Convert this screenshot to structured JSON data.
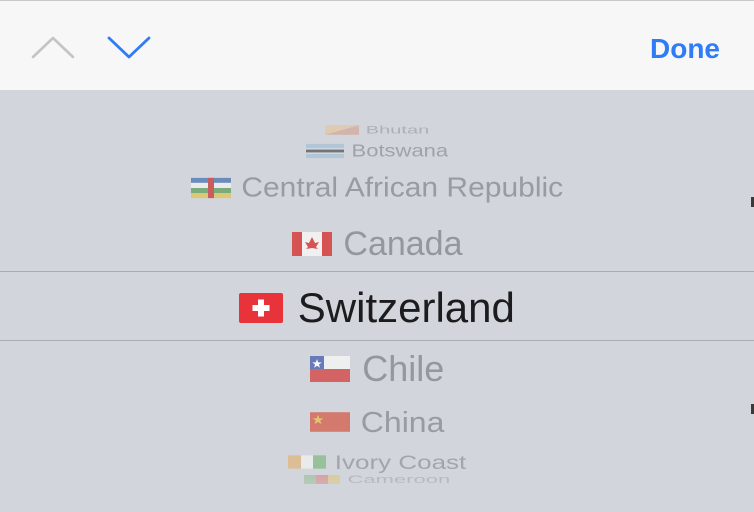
{
  "toolbar": {
    "previous_icon": "chevron-up-icon",
    "next_icon": "chevron-down-icon",
    "done_label": "Done",
    "accent": "#2f7cf6",
    "disabled_color": "#c4c4c6"
  },
  "picker": {
    "selected_country": "Switzerland",
    "rows": [
      {
        "label": "Bhutan",
        "flag": "flag-bhutan"
      },
      {
        "label": "Botswana",
        "flag": "flag-botswana"
      },
      {
        "label": "Central African Republic",
        "flag": "flag-central-african-republic"
      },
      {
        "label": "Canada",
        "flag": "flag-canada"
      },
      {
        "label": "Switzerland",
        "flag": "flag-switzerland"
      },
      {
        "label": "Chile",
        "flag": "flag-chile"
      },
      {
        "label": "China",
        "flag": "flag-china"
      },
      {
        "label": "Ivory Coast",
        "flag": "flag-ivory-coast"
      },
      {
        "label": "Cameroon",
        "flag": "flag-cameroon"
      }
    ]
  }
}
